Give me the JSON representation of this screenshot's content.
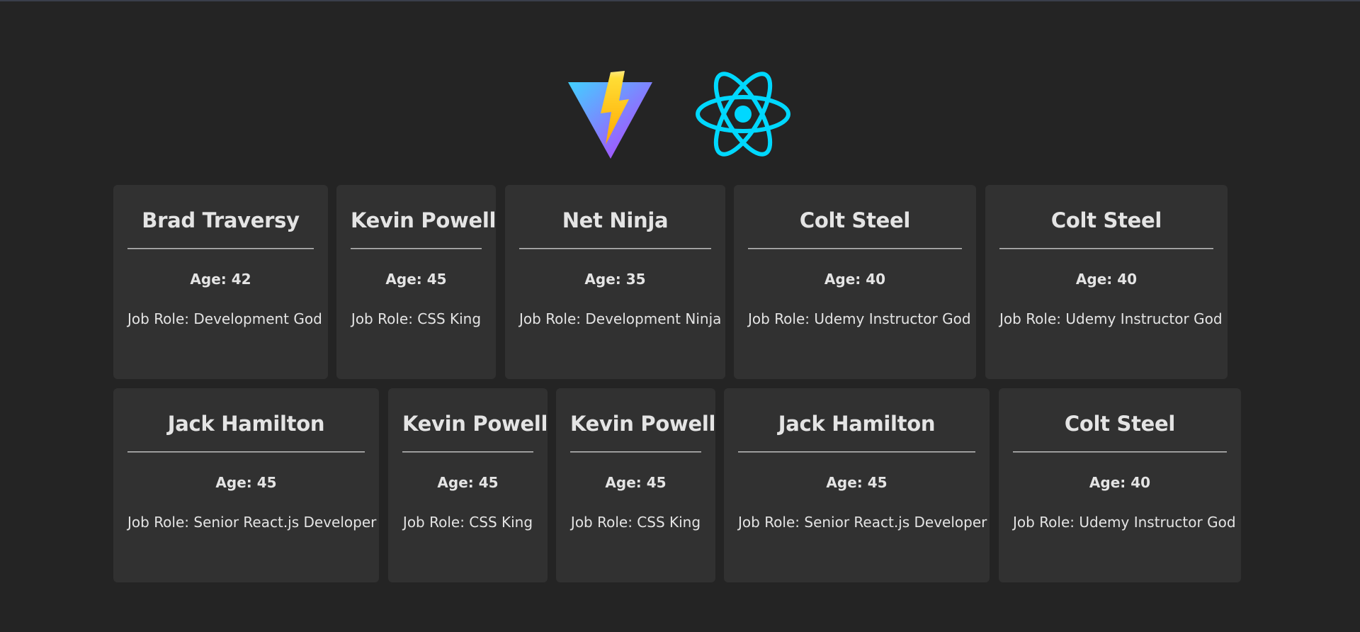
{
  "logos": [
    "vite-logo",
    "react-logo"
  ],
  "colors": {
    "background": "#242424",
    "card": "#313131",
    "react": "#00d8ff"
  },
  "cards": [
    {
      "name": "Brad Traversy",
      "age": "Age: 42",
      "job": "Job Role: Development God"
    },
    {
      "name": "Kevin Powell",
      "age": "Age: 45",
      "job": "Job Role: CSS King"
    },
    {
      "name": "Net Ninja",
      "age": "Age: 35",
      "job": "Job Role: Development Ninja"
    },
    {
      "name": "Colt Steel",
      "age": "Age: 40",
      "job": "Job Role: Udemy Instructor God"
    },
    {
      "name": "Colt Steel",
      "age": "Age: 40",
      "job": "Job Role: Udemy Instructor God"
    },
    {
      "name": "Jack Hamilton",
      "age": "Age: 45",
      "job": "Job Role: Senior React.js Developer"
    },
    {
      "name": "Kevin Powell",
      "age": "Age: 45",
      "job": "Job Role: CSS King"
    },
    {
      "name": "Kevin Powell",
      "age": "Age: 45",
      "job": "Job Role: CSS King"
    },
    {
      "name": "Jack Hamilton",
      "age": "Age: 45",
      "job": "Job Role: Senior React.js Developer"
    },
    {
      "name": "Colt Steel",
      "age": "Age: 40",
      "job": "Job Role: Udemy Instructor God"
    }
  ]
}
